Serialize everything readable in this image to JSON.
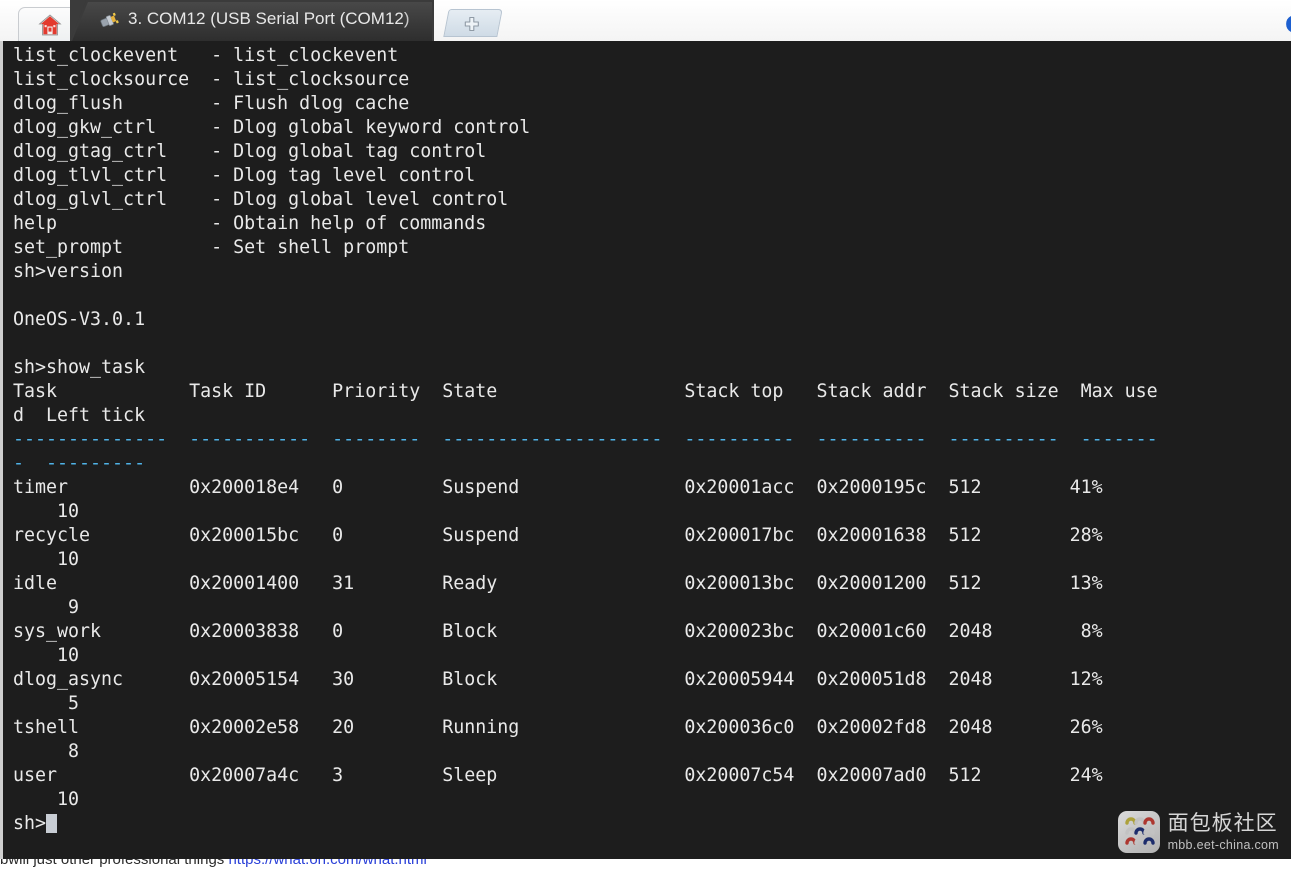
{
  "window": {
    "tabs": [
      {
        "name": "home-tab",
        "icon": "home-icon",
        "label": ""
      },
      {
        "name": "serial-tab",
        "icon": "plug-icon",
        "label": "3. COM12  (USB Serial Port (COM12)",
        "close_label": "×",
        "active": true
      }
    ],
    "new_tab_label": "+",
    "corner_icon": "partial-blue-icon"
  },
  "terminal": {
    "prompt": "sh>",
    "help_rows": [
      {
        "cmd": "list_clockevent ",
        "desc": "- list_clockevent"
      },
      {
        "cmd": "list_clocksource",
        "desc": "- list_clocksource"
      },
      {
        "cmd": "dlog_flush      ",
        "desc": "- Flush dlog cache"
      },
      {
        "cmd": "dlog_gkw_ctrl   ",
        "desc": "- Dlog global keyword control"
      },
      {
        "cmd": "dlog_gtag_ctrl  ",
        "desc": "- Dlog global tag control"
      },
      {
        "cmd": "dlog_tlvl_ctrl  ",
        "desc": "- Dlog tag level control"
      },
      {
        "cmd": "dlog_glvl_ctrl  ",
        "desc": "- Dlog global level control"
      },
      {
        "cmd": "help            ",
        "desc": "- Obtain help of commands"
      },
      {
        "cmd": "set_prompt      ",
        "desc": "- Set shell prompt"
      }
    ],
    "command_version": "version",
    "version_output": "OneOS-V3.0.1",
    "command_show_task": "show_task",
    "task_table": {
      "headers": [
        "Task",
        "Task ID",
        "Priority",
        "State",
        "Stack top",
        "Stack addr",
        "Stack size",
        "Max used",
        "Left tick"
      ],
      "header_line_1": "Task            Task ID      Priority  State                 Stack top   Stack addr  Stack size  Max use",
      "header_line_2": "d  Left tick",
      "separator_line_1": "--------------  -----------  --------  --------------------  ----------  ----------  ----------  -------",
      "separator_line_2": "-  ---------",
      "rows": [
        {
          "task": "timer",
          "task_id": "0x200018e4",
          "priority": "0",
          "state": "Suspend",
          "stack_top": "0x20001acc",
          "stack_addr": "0x2000195c",
          "stack_size": "512",
          "max_used": "41%",
          "left_tick": "10"
        },
        {
          "task": "recycle",
          "task_id": "0x200015bc",
          "priority": "0",
          "state": "Suspend",
          "stack_top": "0x200017bc",
          "stack_addr": "0x20001638",
          "stack_size": "512",
          "max_used": "28%",
          "left_tick": "10"
        },
        {
          "task": "idle",
          "task_id": "0x20001400",
          "priority": "31",
          "state": "Ready",
          "stack_top": "0x200013bc",
          "stack_addr": "0x20001200",
          "stack_size": "512",
          "max_used": "13%",
          "left_tick": "9"
        },
        {
          "task": "sys_work",
          "task_id": "0x20003838",
          "priority": "0",
          "state": "Block",
          "stack_top": "0x200023bc",
          "stack_addr": "0x20001c60",
          "stack_size": "2048",
          "max_used": "8%",
          "left_tick": "10"
        },
        {
          "task": "dlog_async",
          "task_id": "0x20005154",
          "priority": "30",
          "state": "Block",
          "stack_top": "0x20005944",
          "stack_addr": "0x200051d8",
          "stack_size": "2048",
          "max_used": "12%",
          "left_tick": "5"
        },
        {
          "task": "tshell",
          "task_id": "0x20002e58",
          "priority": "20",
          "state": "Running",
          "stack_top": "0x200036c0",
          "stack_addr": "0x20002fd8",
          "stack_size": "2048",
          "max_used": "26%",
          "left_tick": "8"
        },
        {
          "task": "user",
          "task_id": "0x20007a4c",
          "priority": "3",
          "state": "Sleep",
          "stack_top": "0x20007c54",
          "stack_addr": "0x20007ad0",
          "stack_size": "512",
          "max_used": "24%",
          "left_tick": "10"
        }
      ]
    }
  },
  "watermark": {
    "cn_text": "面包板社区",
    "en_text": "mbb.eet-china.com"
  },
  "colors": {
    "terminal_bg": "#1d1d1d",
    "terminal_fg": "#e9e9e9",
    "separator": "#4fb3e8",
    "tab_active_bg": "#3b3b3b",
    "cursor": "#c8cdd4"
  }
}
